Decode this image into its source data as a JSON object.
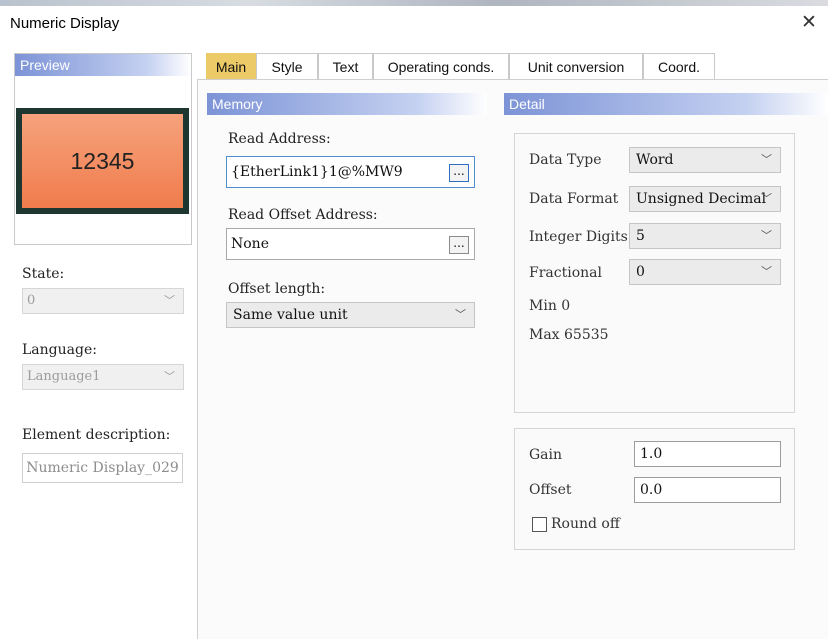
{
  "window": {
    "title": "Numeric Display"
  },
  "preview": {
    "header": "Preview",
    "value": "12345"
  },
  "left": {
    "state_label": "State:",
    "state_value": "0",
    "language_label": "Language:",
    "language_value": "Language1",
    "element_description_label": "Element description:",
    "element_description_value": "Numeric Display_029"
  },
  "tabs": [
    {
      "label": "Main",
      "active": true
    },
    {
      "label": "Style"
    },
    {
      "label": "Text"
    },
    {
      "label": "Operating conds."
    },
    {
      "label": "Unit conversion"
    },
    {
      "label": "Coord."
    }
  ],
  "memory": {
    "header": "Memory",
    "read_address_label": "Read Address:",
    "read_address_value": "{EtherLink1}1@%MW9",
    "read_offset_label": "Read Offset Address:",
    "read_offset_value": "None",
    "offset_length_label": "Offset length:",
    "offset_length_value": "Same value unit",
    "browse_label": "..."
  },
  "detail": {
    "header": "Detail",
    "data_type_label": "Data Type",
    "data_type_value": "Word",
    "data_format_label": "Data Format",
    "data_format_value": "Unsigned Decimal",
    "integer_digits_label": "Integer Digits",
    "integer_digits_value": "5",
    "fractional_label": "Fractional",
    "fractional_value": "0",
    "min_text": "Min 0",
    "max_text": "Max 65535",
    "gain_label": "Gain",
    "gain_value": "1.0",
    "offset_label": "Offset",
    "offset_value": "0.0",
    "round_off_label": "Round off",
    "round_off_checked": false
  },
  "icons": {
    "close": "close-icon",
    "dropdown": "chevron-down-icon",
    "browse": "ellipsis-icon"
  }
}
